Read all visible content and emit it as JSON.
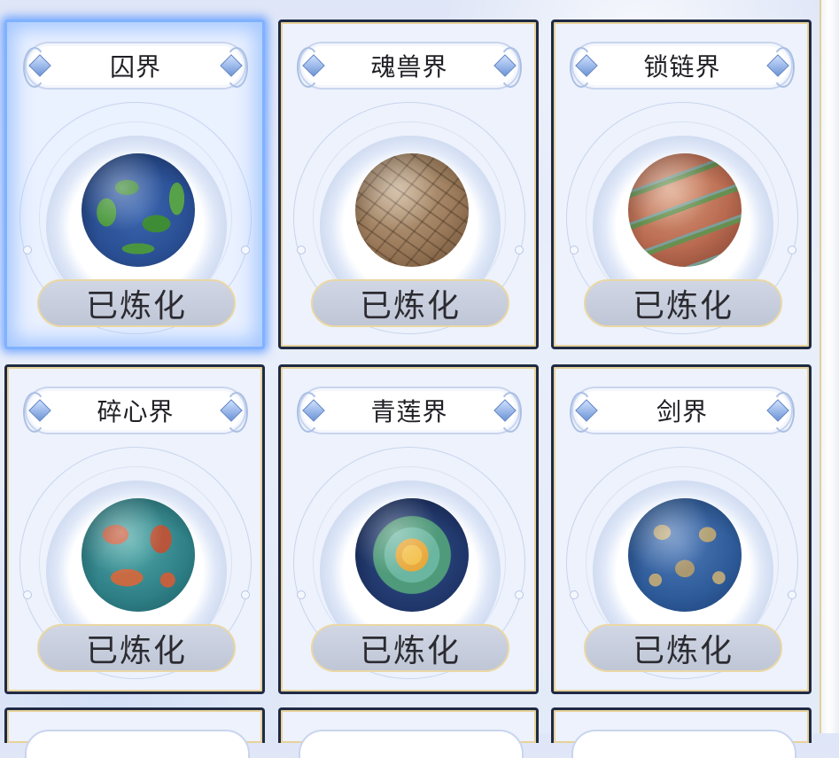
{
  "realms": [
    {
      "name": "囚界",
      "status": "已炼化",
      "selected": true,
      "planet_style": "ocean-green"
    },
    {
      "name": "魂兽界",
      "status": "已炼化",
      "selected": false,
      "planet_style": "cracked-earth"
    },
    {
      "name": "锁链界",
      "status": "已炼化",
      "selected": false,
      "planet_style": "chained-red"
    },
    {
      "name": "碎心界",
      "status": "已炼化",
      "selected": false,
      "planet_style": "shattered-teal"
    },
    {
      "name": "青莲界",
      "status": "已炼化",
      "selected": false,
      "planet_style": "lotus-blue"
    },
    {
      "name": "剑界",
      "status": "已炼化",
      "selected": false,
      "planet_style": "sword-blue"
    }
  ],
  "colors": {
    "card_border": "#1f2a44",
    "card_gold": "#e8d29a",
    "selected_glow": "#7fb2ff"
  }
}
